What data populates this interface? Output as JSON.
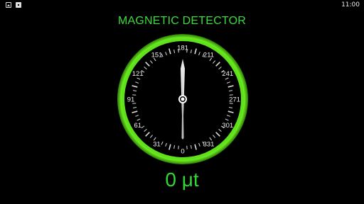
{
  "status_bar": {
    "time": "11:00",
    "icons": [
      "image-notification-icon",
      "store-notification-icon"
    ]
  },
  "title": "MAGNETIC DETECTOR",
  "dial": {
    "labels": [
      "0",
      "31",
      "61",
      "91",
      "121",
      "151",
      "181",
      "211",
      "241",
      "271",
      "301",
      "331"
    ],
    "needle_value": 0,
    "ring_color": "#5be11a",
    "face_color": "#000000"
  },
  "reading": {
    "value": "0",
    "unit": "μt",
    "display": "0 μt"
  },
  "colors": {
    "accent": "#3ddc3d",
    "ring": "#5be11a",
    "background": "#000000"
  }
}
